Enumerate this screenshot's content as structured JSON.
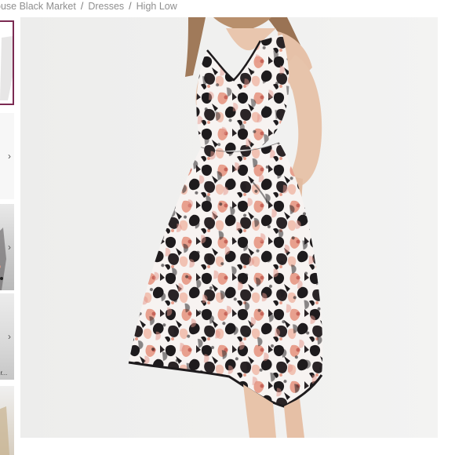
{
  "breadcrumb": {
    "items": [
      "ouse Black Market",
      "Dresses",
      "High Low"
    ],
    "separator": "/"
  },
  "thumbnails": {
    "chevron": "›",
    "caption_4": "gr..."
  },
  "colors": {
    "selected_border": "#7b2a52",
    "breadcrumb_text": "#8f8f8f",
    "image_background": "#f0f0ef",
    "dress_black": "#1e1b1d",
    "dress_blush": "#e8a08e",
    "dress_white": "#f7f3f1"
  }
}
